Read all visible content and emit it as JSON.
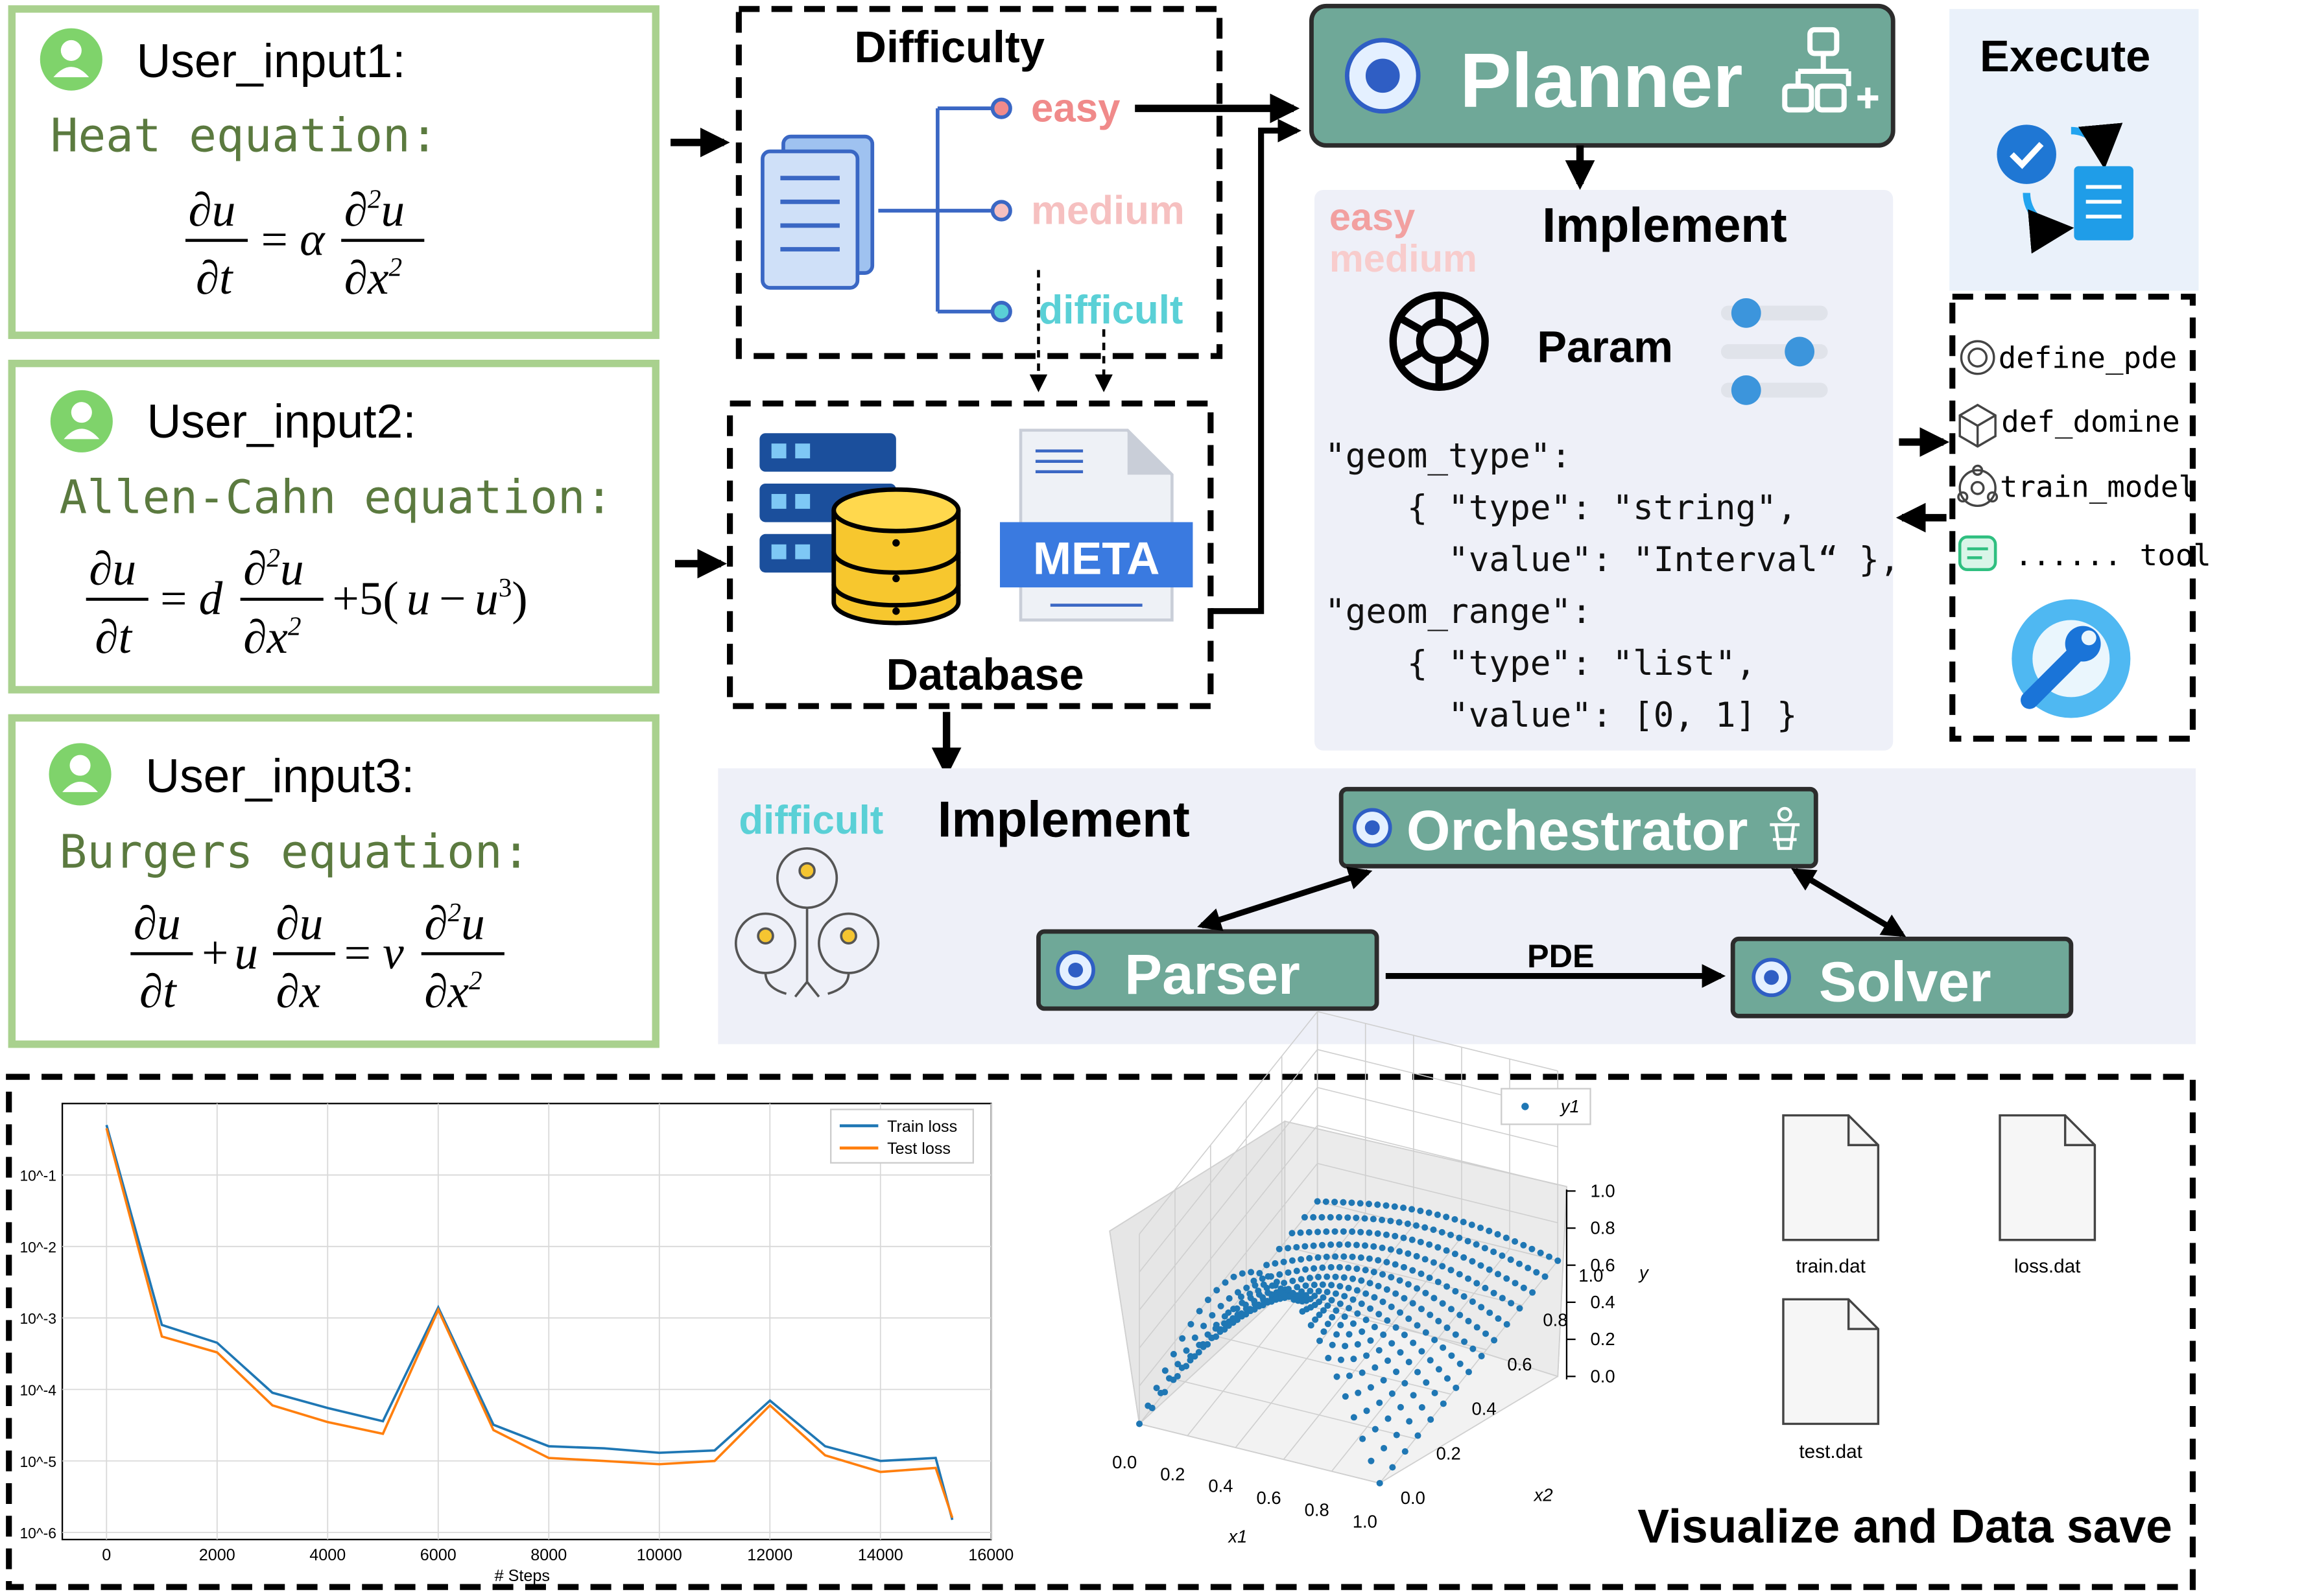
{
  "inputs": [
    {
      "label": "User_input1:",
      "equation_name": "Heat equation:"
    },
    {
      "label": "User_input2:",
      "equation_name": "Allen-Cahn equation:"
    },
    {
      "label": "User_input3:",
      "equation_name": "Burgers equation:"
    }
  ],
  "difficulty": {
    "title": "Difficulty",
    "levels": [
      "easy",
      "medium",
      "difficult"
    ],
    "level_colors": [
      "#f08a8a",
      "#f6c0c0",
      "#5ad0d6"
    ]
  },
  "database": {
    "title": "Database",
    "meta_label": "META"
  },
  "planner": {
    "title": "Planner"
  },
  "implement_top": {
    "tags": [
      "easy",
      "medium"
    ],
    "title": "Implement",
    "param_label": "Param",
    "code_lines": [
      "\"geom_type\":",
      "    { \"type\": \"string\",",
      "      \"value\": \"Interval“ },",
      "\"geom_range\":",
      "    { \"type\": \"list\",",
      "      \"value\": [0, 1] }"
    ]
  },
  "execute": {
    "title": "Execute"
  },
  "tools": {
    "items": [
      "define_pde",
      "def_domine",
      "train_model",
      "...... tool"
    ]
  },
  "implement_bottom": {
    "tag": "difficult",
    "title": "Implement",
    "orchestrator": "Orchestrator",
    "parser": "Parser",
    "solver": "Solver",
    "edge_label": "PDE"
  },
  "visualize": {
    "title": "Visualize and Data save",
    "files": [
      "train.dat",
      "loss.dat",
      "test.dat"
    ]
  },
  "colors": {
    "green_border": "#a9d18e",
    "teal_box": "#6fa898",
    "panel_bg": "#eef0f8",
    "train_loss": "#1f77b4",
    "test_loss": "#ff7f0e",
    "scatter_point": "#1f77b4"
  },
  "chart_data": [
    {
      "type": "line",
      "title": "",
      "xlabel": "# Steps",
      "ylabel": "",
      "yscale": "log",
      "xlim": [
        -800,
        16000
      ],
      "ylim_log10": [
        -6.1,
        -0.0
      ],
      "x_ticks": [
        "0",
        "2000",
        "4000",
        "6000",
        "8000",
        "10000",
        "12000",
        "14000",
        "16000"
      ],
      "y_ticks": [
        "10^-6",
        "10^-5",
        "10^-4",
        "10^-3",
        "10^-2",
        "10^-1"
      ],
      "grid": true,
      "legend": "top-right",
      "x": [
        0,
        1000,
        2000,
        3000,
        4000,
        5000,
        6000,
        7000,
        8000,
        9000,
        10000,
        11000,
        12000,
        13000,
        14000,
        15000,
        15300
      ],
      "series": [
        {
          "name": "Train loss",
          "values": [
            0.5,
            0.0008,
            0.00045,
            9e-05,
            5.5e-05,
            3.6e-05,
            0.0014,
            3.2e-05,
            1.6e-05,
            1.5e-05,
            1.3e-05,
            1.4e-05,
            7e-05,
            1.6e-05,
            1e-05,
            1.1e-05,
            1.5e-06
          ]
        },
        {
          "name": "Test loss",
          "values": [
            0.45,
            0.00055,
            0.00033,
            6e-05,
            3.5e-05,
            2.4e-05,
            0.0013,
            2.7e-05,
            1.1e-05,
            1e-05,
            9e-06,
            1e-05,
            6e-05,
            1.2e-05,
            7e-06,
            8e-06,
            1.6e-06
          ]
        }
      ]
    },
    {
      "type": "scatter",
      "projection": "3d",
      "xlabel": "x1",
      "ylabel": "x2",
      "zlabel": "y",
      "x_ticks": [
        "0.0",
        "0.2",
        "0.4",
        "0.6",
        "0.8",
        "1.0"
      ],
      "y_ticks": [
        "0.0",
        "0.2",
        "0.4",
        "0.6",
        "0.8",
        "1.0"
      ],
      "z_ticks": [
        "0.0",
        "0.2",
        "0.4",
        "0.6",
        "0.8",
        "1.0"
      ],
      "legend": "top",
      "series": [
        {
          "name": "y1",
          "function": "sin(pi*x1) along x1, decaying with x2"
        }
      ]
    }
  ]
}
